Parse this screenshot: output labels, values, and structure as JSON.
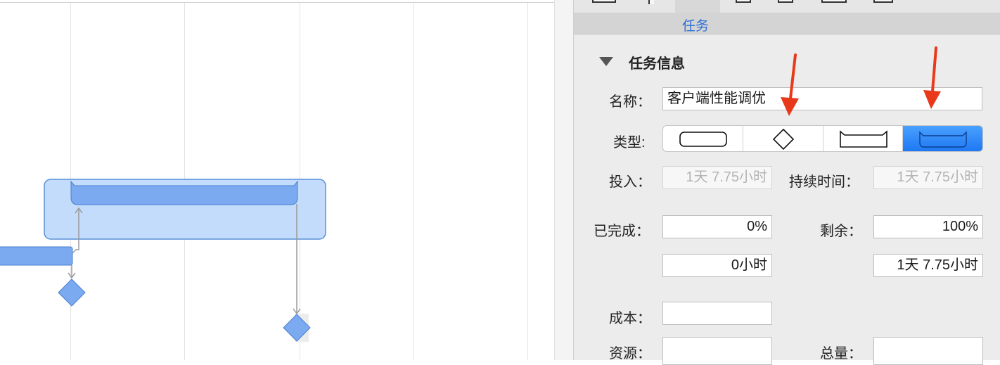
{
  "inspector": {
    "tab_label": "任务",
    "section_title": "任务信息",
    "name_label": "名称：",
    "name_value": "客户端性能调优",
    "type_label": "类型:",
    "type_options": [
      "task-icon",
      "milestone-icon",
      "hammock-icon",
      "group-icon"
    ],
    "type_selected": "group-icon",
    "effort_label": "投入：",
    "effort_value": "1天 7.75小时",
    "duration_label": "持续时间：",
    "duration_value": "1天 7.75小时",
    "completed_label": "已完成：",
    "completed_value": "0%",
    "remaining_label": "剩余：",
    "remaining_value": "100%",
    "completed_hours": "0小时",
    "remaining_hours": "1天 7.75小时",
    "cost_label": "成本：",
    "cost_value": "",
    "resource_label": "资源：",
    "resource_value": "",
    "total_label": "总量：",
    "total_value": ""
  },
  "colors": {
    "accent": "#1e78f2",
    "bar_fill": "#7baaf0",
    "group_fill": "#c3dcfb",
    "annotation_arrow": "#e83a1a"
  }
}
